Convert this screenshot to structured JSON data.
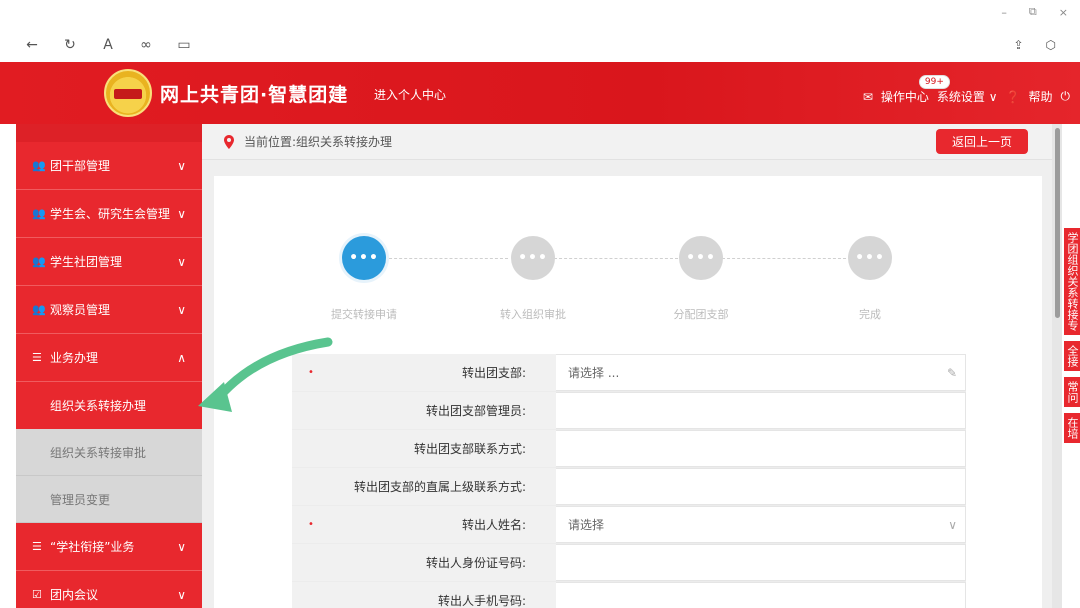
{
  "window_controls": {
    "minimize": "–",
    "restore": "⧉",
    "close": "×"
  },
  "browser": {
    "back_icon": "←",
    "reload_icon": "↻",
    "reader_icon": "A",
    "link_icon": "∞",
    "tab_icon": "▭",
    "share_icon": "⇪",
    "extensions_icon": "⬡"
  },
  "header": {
    "brand": "网上共青团·智慧团建",
    "personal_center": "进入个人中心",
    "ops_center": "操作中心",
    "ops_badge": "99+",
    "settings": "系统设置",
    "help": "帮助"
  },
  "sidebar": {
    "items": [
      {
        "label": "团干部管理",
        "icon": "users-icon",
        "chev": "∨"
      },
      {
        "label": "学生会、研究生会管理",
        "icon": "users-icon",
        "chev": "∨"
      },
      {
        "label": "学生社团管理",
        "icon": "users-icon",
        "chev": "∨"
      },
      {
        "label": "观察员管理",
        "icon": "users-icon",
        "chev": "∨"
      },
      {
        "label": "业务办理",
        "icon": "list-icon",
        "chev": "∧"
      }
    ],
    "sub_items": [
      {
        "label": "组织关系转接办理"
      },
      {
        "label": "组织关系转接审批"
      },
      {
        "label": "管理员变更"
      }
    ],
    "bottom_items": [
      {
        "label": "“学社衔接”业务",
        "icon": "list-icon",
        "chev": "∨"
      },
      {
        "label": "团内会议",
        "icon": "check-icon",
        "chev": "∨"
      }
    ]
  },
  "breadcrumb": {
    "text": "当前位置:组织关系转接办理"
  },
  "back_button": "返回上一页",
  "steps": [
    {
      "label": "提交转接申请",
      "mark": "•••"
    },
    {
      "label": "转入组织审批",
      "mark": "•••"
    },
    {
      "label": "分配团支部",
      "mark": "•••"
    },
    {
      "label": "完成",
      "mark": "•••"
    }
  ],
  "form": {
    "rows": [
      {
        "label": "转出团支部:",
        "value": "请选择 ...",
        "required": true,
        "tail": "✎"
      },
      {
        "label": "转出团支部管理员:",
        "value": "",
        "required": false,
        "tail": ""
      },
      {
        "label": "转出团支部联系方式:",
        "value": "",
        "required": false,
        "tail": ""
      },
      {
        "label": "转出团支部的直属上级联系方式:",
        "value": "",
        "required": false,
        "tail": ""
      },
      {
        "label": "转出人姓名:",
        "value": "请选择",
        "required": true,
        "tail": "∨"
      },
      {
        "label": "转出人身份证号码:",
        "value": "",
        "required": false,
        "tail": ""
      },
      {
        "label": "转出人手机号码:",
        "value": "",
        "required": false,
        "tail": ""
      }
    ]
  },
  "float_tabs": [
    "学团组织关系转接专",
    "全接",
    "常问",
    "在培"
  ],
  "colors": {
    "accent": "#e8282e",
    "step_active": "#2b9bdc",
    "arrow": "#59c48f"
  }
}
